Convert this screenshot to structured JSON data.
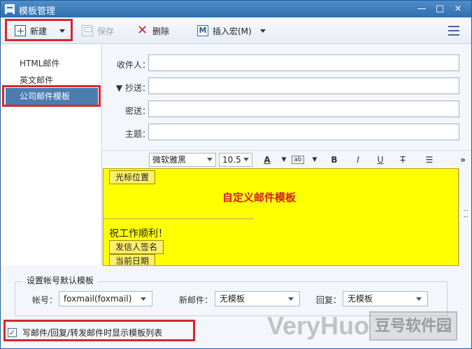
{
  "window": {
    "title": "模板管理"
  },
  "toolbar": {
    "new_label": "新建",
    "save_label": "保存",
    "delete_label": "删除",
    "insert_macro_label": "插入宏(M)"
  },
  "sidebar": {
    "items": [
      {
        "label": "HTML邮件"
      },
      {
        "label": "英文邮件"
      },
      {
        "label": "公司邮件模板"
      }
    ],
    "selected_index": 2
  },
  "compose": {
    "to_label": "收件人：",
    "cc_label": "抄送：",
    "bcc_label": "密送：",
    "subject_label": "主题："
  },
  "formatting": {
    "font": "微软雅黑",
    "size": "10.5",
    "bold": "B",
    "italic": "I",
    "underline": "U",
    "strike": "T",
    "more": "»"
  },
  "editor": {
    "cursor_token": "光标位置",
    "headline": "自定义邮件模板",
    "greeting": "祝工作顺利！",
    "sender_signature_token": "发信人签名",
    "current_date_token": "当前日期",
    "background_color": "#ffff00",
    "headline_color": "#d02020"
  },
  "defaults": {
    "group_title": "设置帐号默认模板",
    "account_label": "帐号：",
    "account_value": "foxmail(foxmail)",
    "new_mail_label": "新邮件：",
    "new_mail_value": "无模板",
    "reply_label": "回复：",
    "reply_value": "无模板"
  },
  "options": {
    "show_template_list_label": "写邮件/回复/转发邮件时显示模板列表",
    "show_template_list_checked": true
  },
  "watermark": {
    "text": "VeryHuo",
    "badge": "豆号软件园"
  }
}
